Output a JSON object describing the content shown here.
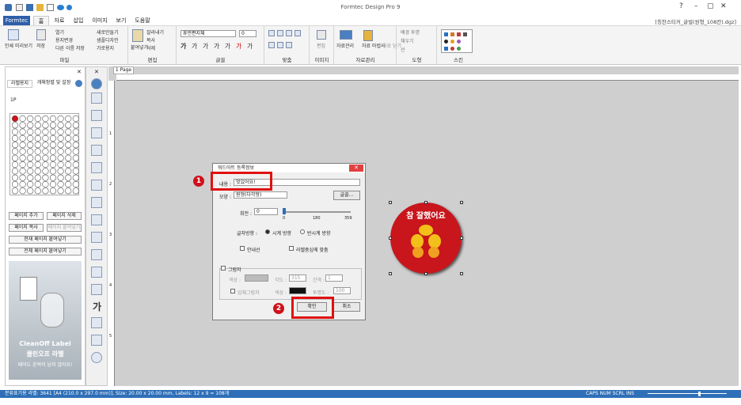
{
  "window": {
    "title": "Formtec Design Pro 9",
    "file": "[칭찬스티커_글벌(원형_108칸).dgz]",
    "controls": [
      "?",
      "–",
      "▢",
      "✕"
    ]
  },
  "tabs": [
    "Formtec",
    "홈",
    "자료",
    "삽입",
    "이미지",
    "보기",
    "도움말"
  ],
  "ribbon": {
    "file_group": {
      "label": "파일",
      "items": [
        "인쇄 미리보기",
        "저장",
        "열기",
        "용지변경",
        "다른 이름 저장",
        "새로만들기",
        "샘플디자인",
        "가로용지"
      ]
    },
    "edit_group": {
      "label": "편집",
      "items": [
        "붙여넣기",
        "잘라내기",
        "복사",
        "삭제"
      ]
    },
    "font_group": {
      "label": "글꼴",
      "font": "휴먼편지체",
      "size": "0",
      "styles": [
        "가",
        "가",
        "가",
        "가",
        "가",
        "가",
        "가"
      ]
    },
    "align_group": {
      "label": "맞춤"
    },
    "image_group": {
      "label": "이미지",
      "items": [
        "편집"
      ]
    },
    "data_group": {
      "label": "자료관리",
      "items": [
        "자료관리",
        "자료 마법사",
        "자료 닫기"
      ]
    },
    "shape_group": {
      "label": "도형",
      "items": [
        "채우기",
        "선",
        "배경 투명"
      ]
    },
    "style_group": {
      "label": "스킨"
    }
  },
  "left_panel": {
    "tabs": [
      "라벨용지",
      "개체정렬 및 설정"
    ],
    "page_tab": "1P",
    "buttons": [
      "페이지 추가",
      "페이지 삭제",
      "페이지 복사",
      "페이지 붙여넣기",
      "현재 페이지 붙여넣기",
      "전체 페이지 붙여넣기"
    ],
    "ad": {
      "brand": "CleanOff Label",
      "title": "클린오프 라벨",
      "subtitle": "떼어도 흔적이 남지 않아요!"
    }
  },
  "canvas": {
    "page_tab": "1 Page",
    "ruler_marks": [
      "1",
      "2",
      "3",
      "4",
      "5"
    ]
  },
  "sticker": {
    "text": "참 잘했어요",
    "fill": "#c8161c"
  },
  "dialog": {
    "title": "워드아트 등록정보",
    "content_label": "내용 :",
    "content_value": "멋있어요!",
    "shape_label": "모양 :",
    "shape_value": "원형(다각형)",
    "font_button": "글꼴...",
    "rotation_label": "회전 :",
    "rotation_value": "0",
    "slider_ticks": [
      "0",
      "180",
      "359"
    ],
    "direction_label": "글자방향 :",
    "direction_opts": [
      "시계 방향",
      "반시계 방향"
    ],
    "inner_label": "안내선",
    "center_label": "라벨중심에 맞춤",
    "shadow_label": "그림자",
    "color_label": "색상 :",
    "angle_label": "각도 :",
    "angle_value": "315",
    "gap_label": "간격 :",
    "gap_value": "1",
    "blur_label": "입체그림자",
    "color2_label": "색상 :",
    "opacity_label": "투명도 :",
    "opacity_value": "100",
    "ok": "확인",
    "cancel": "취소"
  },
  "annotations": [
    "1",
    "2"
  ],
  "status": {
    "text": "분류표기용 라벨: 3641 [A4 (210.0 x 297.0 mm)], Size: 20.00 x 20.00 mm, Labels: 12 x 9 = 108개",
    "keys": "CAPS NUM SCRL INS"
  }
}
